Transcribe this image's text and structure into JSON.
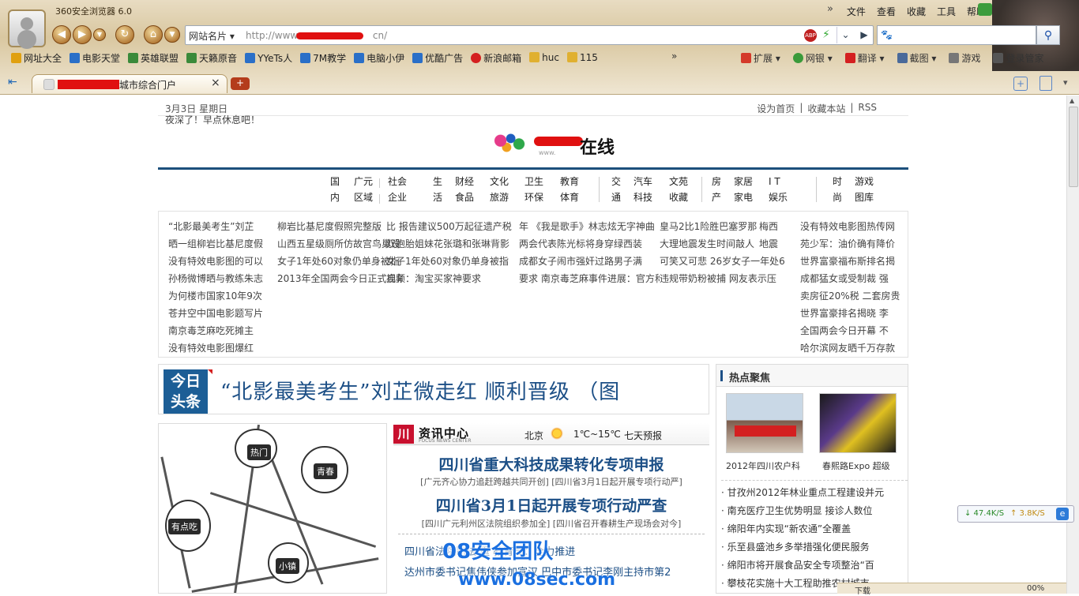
{
  "browser": {
    "title": "360安全浏览器 6.0",
    "menus": [
      "文件",
      "查看",
      "收藏",
      "工具",
      "帮助"
    ],
    "address_label": "网站名片",
    "url_start": "http://www.",
    "url_end": "cn/",
    "search_engine": "🐾",
    "bookmarks": [
      {
        "label": "网址大全",
        "color": "#e0a010"
      },
      {
        "label": "电影天堂",
        "color": "#2a6fc8"
      },
      {
        "label": "英雄联盟",
        "color": "#3a8a3a"
      },
      {
        "label": "天籁原音",
        "color": "#3a8a3a"
      },
      {
        "label": "YYeTs人",
        "color": "#2a6fc8"
      },
      {
        "label": "7M教学",
        "color": "#2a6fc8"
      },
      {
        "label": "电脑小伊",
        "color": "#2a6fc8"
      },
      {
        "label": "优酷广告",
        "color": "#2a6fc8"
      },
      {
        "label": "新浪邮箱",
        "color": "#d42020"
      },
      {
        "label": "huc",
        "color": "#e0b030"
      },
      {
        "label": "115",
        "color": "#e0b030"
      }
    ],
    "more_bookmarks": "»",
    "tools": [
      "扩展",
      "网银",
      "翻译",
      "截图",
      "游戏",
      "登录管家"
    ],
    "tab_title": "城市综合门户",
    "status_download": "下载",
    "status_zoom": "00%"
  },
  "page": {
    "date": "3月3日  星期日",
    "greeting": "夜深了！早点休息吧！",
    "toplinks": [
      "设为首页",
      "|",
      "收藏本站",
      "|",
      "RSS"
    ],
    "logo_text": "在线",
    "logo_url": "www.",
    "nav": [
      {
        "head": [
          "国",
          "内"
        ],
        "items": [
          [
            "广元",
            "社会"
          ],
          [
            "区域",
            "企业"
          ]
        ]
      },
      {
        "head": [
          "生",
          "活"
        ],
        "items": [
          [
            "财经",
            "文化",
            "卫生",
            "教育"
          ],
          [
            "食品",
            "旅游",
            "环保",
            "体育"
          ]
        ]
      },
      {
        "head": [
          "交",
          "通"
        ],
        "items": [
          [
            "汽车",
            "文苑"
          ],
          [
            "科技",
            "收藏"
          ]
        ]
      },
      {
        "head": [
          "房",
          "产"
        ],
        "items": [
          [
            "家居",
            "I T"
          ],
          [
            "家电",
            "娱乐"
          ]
        ]
      },
      {
        "head": [
          "时",
          "尚"
        ],
        "items": [
          [
            "游戏"
          ],
          [
            "图库"
          ]
        ]
      }
    ],
    "news_col1": [
      "“北影最美考生”刘芷",
      "晒一组柳岩比基尼度假",
      "没有特效电影图的可以",
      "孙杨微博晒与教练朱志",
      "为何楼市国家10年9次",
      "苍井空中国电影题写片",
      "南京毒芝麻吃死摊主",
      "没有特效电影图爆红"
    ],
    "news_col2": [
      "柳岩比基尼度假照完整版",
      "山西五星级厕所仿故宫鸟巢设",
      "女子1年处60对象仍单身被指",
      "2013年全国两会今日正式启幕"
    ],
    "news_col3": [
      "比  报告建议500万起征遗产税",
      "双胞胎姐妹花张璐和张琳背影",
      "女子1年处60对象仍单身被指",
      "视频：淘宝买家神要求"
    ],
    "news_col4": [
      "年  《我是歌手》林志炫无字神曲",
      "两会代表陈光标将身穿绿西装",
      "成都女子闹市强奸过路男子满",
      "要求  南京毒芝麻事件进展：官方称"
    ],
    "news_col5": [
      "皇马2比1险胜巴塞罗那",
      "大理地震发生时间敲人",
      "可笑又可悲  26岁女子一年处6",
      "违规带奶粉被捕  网友表示压"
    ],
    "news_col6": [
      "梅西",
      "地震",
      "",
      ""
    ],
    "news_col7": [
      "没有特效电影图热传网",
      "苑少军：油价确有降价",
      "世界富豪福布斯排名揭",
      "成都猛女或受制裁  强",
      "卖房征20%税  二套房贵",
      "世界富豪排名揭晓  李",
      "全国两会今日开幕  不",
      "哈尔滨网友晒千万存款"
    ],
    "headline_tag": "今日头条",
    "headline": "“北影最美考生”刘芷微走红 顺利晋级 （图",
    "map_labels": [
      "热门",
      "青春",
      "有点吃",
      "小镇"
    ],
    "news_center": {
      "logo": "川",
      "title": "资讯中心",
      "subtitle": "FOCUS NEWS CENTER",
      "city": "北京",
      "temp": "1℃~15℃",
      "forecast": "七天预报",
      "big1": "四川省重大科技成果转化专项申报",
      "sub1": "[广元齐心协力追赶跨越共同开创] [四川省3月1日起开展专项行动严]",
      "big2": "四川省3月1日起开展专项行动严查",
      "sub2": "[四川广元利州区法院组织参加全] [四川省召开春耕生产现场会对今]",
      "line1": "四川省法院司法                  重             教育局：全力推进",
      "line2": "达州市委书记焦伟侠参加宣汉   巴中市委书记李刚主持市第2"
    },
    "hot": {
      "title": "热点聚焦",
      "captions": [
        "2012年四川农户科",
        "春熙路Expo 超级"
      ],
      "items": [
        "甘孜州2012年林业重点工程建设并元",
        "南充医疗卫生优势明显 接诊人数位",
        "绵阳年内实现“新农通”全覆盖",
        "乐至县盛池乡多举措强化便民服务",
        "绵阳市将开展食品安全专项整治“百",
        "攀枝花实施十大工程助推农村城市"
      ]
    }
  },
  "overlay": {
    "speed_down": "↓ 47.4K/S",
    "speed_up": "↑ 3.8K/S",
    "ie": "e",
    "watermark_line1": "08安全团队",
    "watermark_line2": "www.08sec.com"
  }
}
